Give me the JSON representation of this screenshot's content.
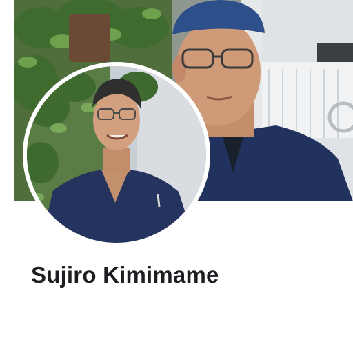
{
  "profile": {
    "name": "Sujiro Kimimame"
  },
  "images": {
    "cover": "cover-photo",
    "avatar": "profile-photo"
  },
  "colors": {
    "name_text": "#1c1e21",
    "scrubs": "#22325f",
    "cap": "#2d4f8a",
    "foliage": "#4d7a3a"
  }
}
